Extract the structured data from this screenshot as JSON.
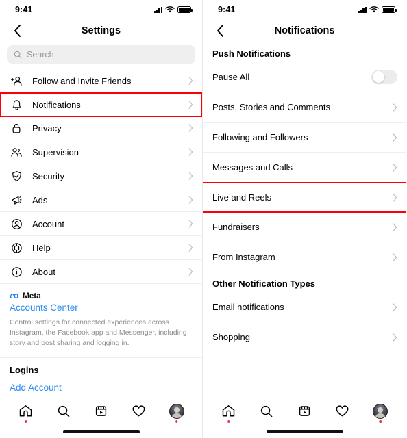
{
  "settings_screen": {
    "status_bar": {
      "time": "9:41",
      "signal_icon": "cellular-bars-icon",
      "wifi_icon": "wifi-icon",
      "battery_icon": "battery-full-icon"
    },
    "header": {
      "back_icon": "back-chevron-icon",
      "title": "Settings"
    },
    "search": {
      "icon": "search-icon",
      "placeholder": "Search",
      "value": ""
    },
    "items": [
      {
        "label": "Follow and Invite Friends",
        "icon": "person-add-icon",
        "chevron": "chevron-right-icon",
        "highlighted": false
      },
      {
        "label": "Notifications",
        "icon": "bell-icon",
        "chevron": "chevron-right-icon",
        "highlighted": true
      },
      {
        "label": "Privacy",
        "icon": "lock-icon",
        "chevron": "chevron-right-icon",
        "highlighted": false
      },
      {
        "label": "Supervision",
        "icon": "people-icon",
        "chevron": "chevron-right-icon",
        "highlighted": false
      },
      {
        "label": "Security",
        "icon": "shield-check-icon",
        "chevron": "chevron-right-icon",
        "highlighted": false
      },
      {
        "label": "Ads",
        "icon": "megaphone-icon",
        "chevron": "chevron-right-icon",
        "highlighted": false
      },
      {
        "label": "Account",
        "icon": "account-circle-icon",
        "chevron": "chevron-right-icon",
        "highlighted": false
      },
      {
        "label": "Help",
        "icon": "lifebuoy-icon",
        "chevron": "chevron-right-icon",
        "highlighted": false
      },
      {
        "label": "About",
        "icon": "info-circle-icon",
        "chevron": "chevron-right-icon",
        "highlighted": false
      }
    ],
    "meta": {
      "logo_icon": "meta-infinity-icon",
      "brand": "Meta",
      "accounts_center_link": "Accounts Center",
      "description": "Control settings for connected experiences across Instagram, the Facebook app and Messenger, including story and post sharing and logging in."
    },
    "logins": {
      "heading": "Logins",
      "add_account_link": "Add Account"
    },
    "tab_bar": [
      {
        "icon": "home-icon",
        "has_dot": true
      },
      {
        "icon": "search-icon",
        "has_dot": false
      },
      {
        "icon": "reels-icon",
        "has_dot": false
      },
      {
        "icon": "heart-icon",
        "has_dot": false
      },
      {
        "icon": "profile-avatar",
        "has_dot": true
      }
    ]
  },
  "notifications_screen": {
    "status_bar": {
      "time": "9:41",
      "signal_icon": "cellular-bars-icon",
      "wifi_icon": "wifi-icon",
      "battery_icon": "battery-full-icon"
    },
    "header": {
      "back_icon": "back-chevron-icon",
      "title": "Notifications"
    },
    "push_section": {
      "heading": "Push Notifications",
      "pause_all": {
        "label": "Pause All",
        "toggle_state": "off"
      },
      "items": [
        {
          "label": "Posts, Stories and Comments",
          "chevron": "chevron-right-icon",
          "highlighted": false
        },
        {
          "label": "Following and Followers",
          "chevron": "chevron-right-icon",
          "highlighted": false
        },
        {
          "label": "Messages and Calls",
          "chevron": "chevron-right-icon",
          "highlighted": false
        },
        {
          "label": "Live and Reels",
          "chevron": "chevron-right-icon",
          "highlighted": true
        },
        {
          "label": "Fundraisers",
          "chevron": "chevron-right-icon",
          "highlighted": false
        },
        {
          "label": "From Instagram",
          "chevron": "chevron-right-icon",
          "highlighted": false
        }
      ]
    },
    "other_section": {
      "heading": "Other Notification Types",
      "items": [
        {
          "label": "Email notifications",
          "chevron": "chevron-right-icon",
          "highlighted": false
        },
        {
          "label": "Shopping",
          "chevron": "chevron-right-icon",
          "highlighted": false
        }
      ]
    },
    "tab_bar": [
      {
        "icon": "home-icon",
        "has_dot": true
      },
      {
        "icon": "search-icon",
        "has_dot": false
      },
      {
        "icon": "reels-icon",
        "has_dot": false
      },
      {
        "icon": "heart-icon",
        "has_dot": false
      },
      {
        "icon": "profile-avatar",
        "has_dot": true
      }
    ]
  },
  "colors": {
    "highlight_red": "#fb0007",
    "link_blue": "#2d8cf0",
    "meta_blue": "#1877f2",
    "search_bg": "#efefef",
    "divider": "#efefef",
    "notification_dot": "#ec3750"
  }
}
